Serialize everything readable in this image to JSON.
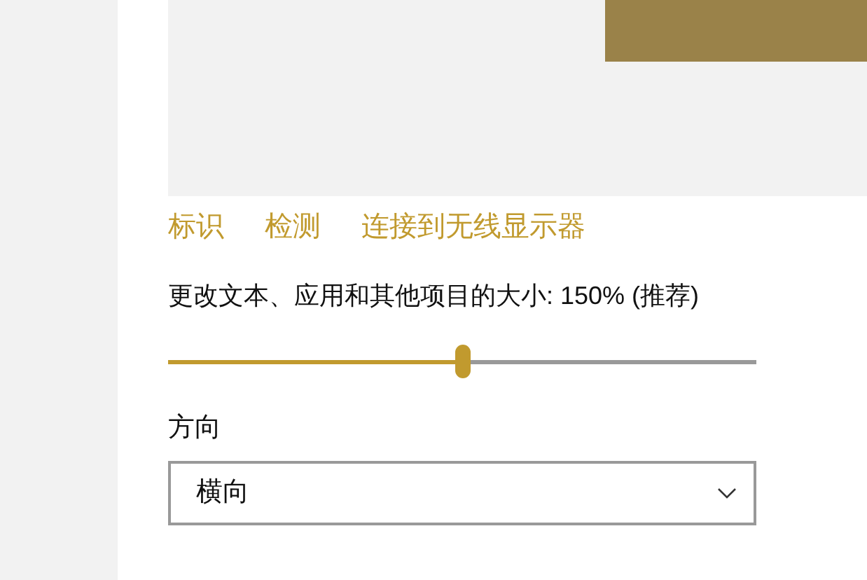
{
  "links": [
    {
      "label": "标识"
    },
    {
      "label": "检测"
    },
    {
      "label": "连接到无线显示器"
    }
  ],
  "scale": {
    "label": "更改文本、应用和其他项目的大小: 150% (推荐)",
    "level": 0.5
  },
  "orientation": {
    "label": "方向",
    "value": "横向"
  }
}
